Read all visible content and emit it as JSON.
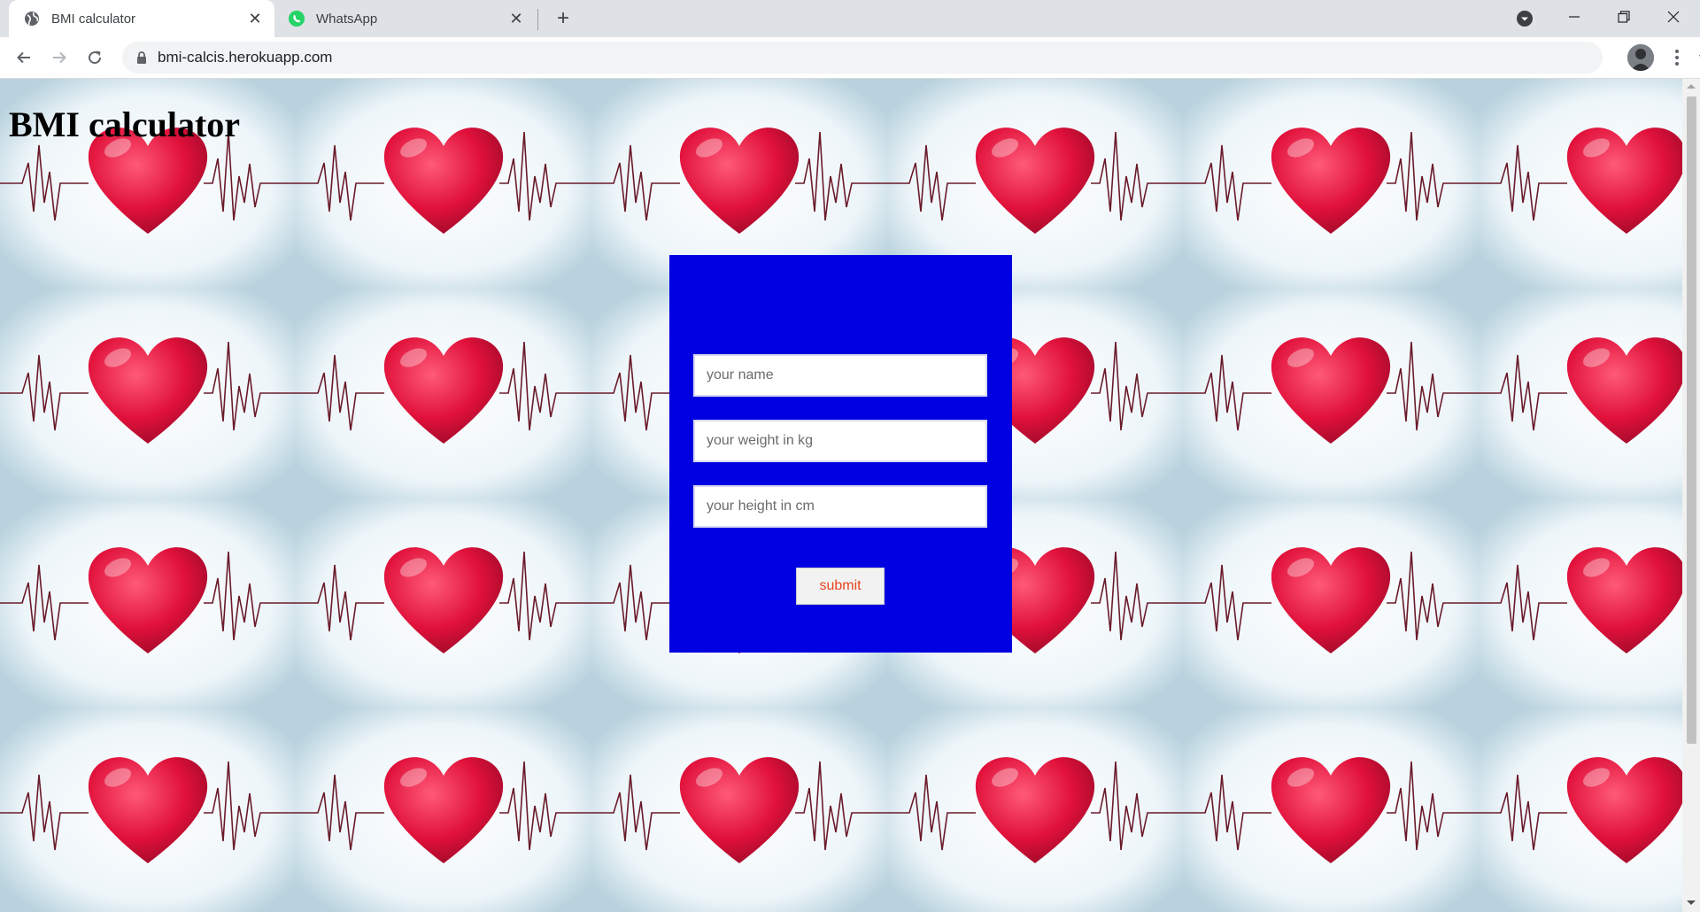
{
  "browser": {
    "tabs": [
      {
        "title": "BMI calculator",
        "icon": "globe-icon",
        "active": true
      },
      {
        "title": "WhatsApp",
        "icon": "whatsapp-icon",
        "active": false
      }
    ],
    "url": "bmi-calcis.herokuapp.com"
  },
  "page": {
    "title": "BMI calculator",
    "form": {
      "name_placeholder": "your name",
      "weight_placeholder": "your weight in kg",
      "height_placeholder": "your height in cm",
      "submit_label": "submit"
    }
  },
  "colors": {
    "form_panel": "#0000e0",
    "submit_text": "#e8431e",
    "heart": "#e0103a"
  }
}
